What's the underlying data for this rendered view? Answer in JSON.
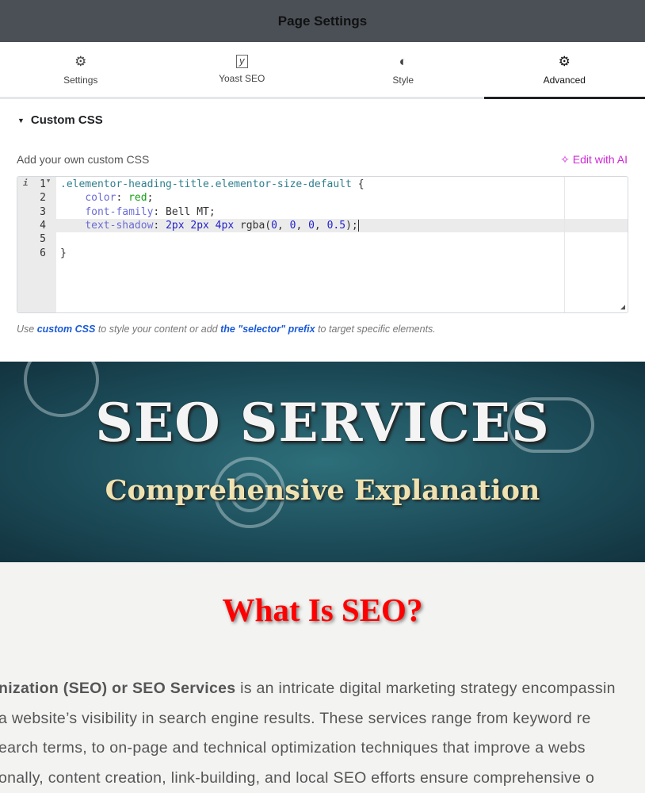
{
  "header": {
    "title": "Page Settings"
  },
  "tabs": [
    {
      "label": "Settings",
      "icon": "gear-icon"
    },
    {
      "label": "Yoast SEO",
      "icon": "yoast-icon"
    },
    {
      "label": "Style",
      "icon": "half-circle-icon"
    },
    {
      "label": "Advanced",
      "icon": "gear-icon",
      "active": true
    }
  ],
  "custom_css": {
    "section_title": "Custom CSS",
    "label": "Add your own custom CSS",
    "ai_button": "Edit with AI",
    "lines": [
      {
        "n": "1",
        "parts": [
          {
            "t": ".elementor-heading-title.elementor-size-default ",
            "c": "sel"
          },
          {
            "t": "{",
            "c": ""
          }
        ]
      },
      {
        "n": "2",
        "parts": [
          {
            "t": "    ",
            "c": ""
          },
          {
            "t": "color",
            "c": "prop"
          },
          {
            "t": ": ",
            "c": ""
          },
          {
            "t": "red",
            "c": "kw"
          },
          {
            "t": ";",
            "c": ""
          }
        ]
      },
      {
        "n": "3",
        "parts": [
          {
            "t": "    ",
            "c": ""
          },
          {
            "t": "font-family",
            "c": "prop"
          },
          {
            "t": ": Bell MT;",
            "c": ""
          }
        ]
      },
      {
        "n": "4",
        "parts": [
          {
            "t": "    ",
            "c": ""
          },
          {
            "t": "text-shadow",
            "c": "prop"
          },
          {
            "t": ": ",
            "c": ""
          },
          {
            "t": "2px 2px 4px",
            "c": "num"
          },
          {
            "t": " rgba(",
            "c": ""
          },
          {
            "t": "0",
            "c": "num"
          },
          {
            "t": ", ",
            "c": ""
          },
          {
            "t": "0",
            "c": "num"
          },
          {
            "t": ", ",
            "c": ""
          },
          {
            "t": "0",
            "c": "num"
          },
          {
            "t": ", ",
            "c": ""
          },
          {
            "t": "0.5",
            "c": "num"
          },
          {
            "t": ");",
            "c": ""
          }
        ]
      },
      {
        "n": "5",
        "parts": []
      },
      {
        "n": "6",
        "parts": [
          {
            "t": "}",
            "c": ""
          }
        ]
      }
    ],
    "help": {
      "pre": "Use ",
      "link1": "custom CSS",
      "mid": " to style your content or add ",
      "link2": "the \"selector\" prefix",
      "post": " to target specific elements."
    }
  },
  "banner": {
    "title": "SEO SERVICES",
    "subtitle": "Comprehensive Explanation"
  },
  "content": {
    "heading": "What Is SEO?",
    "line1_bold": "nization (SEO) or SEO Services",
    "line1_rest": " is an intricate digital marketing strategy encompassin",
    "line2": "a website’s visibility in search engine results. These services range from keyword re",
    "line3": "earch terms, to on-page and technical optimization techniques that improve a webs",
    "line4": "onally, content creation, link-building, and local SEO efforts ensure comprehensive o"
  }
}
